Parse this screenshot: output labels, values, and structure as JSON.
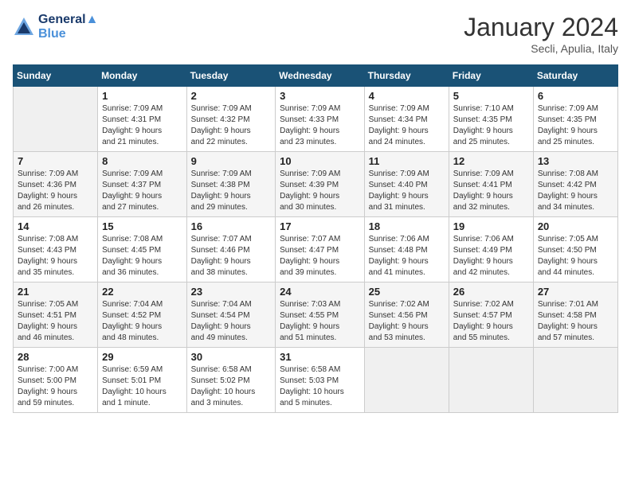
{
  "header": {
    "logo_line1": "General",
    "logo_line2": "Blue",
    "title": "January 2024",
    "subtitle": "Secli, Apulia, Italy"
  },
  "days_of_week": [
    "Sunday",
    "Monday",
    "Tuesday",
    "Wednesday",
    "Thursday",
    "Friday",
    "Saturday"
  ],
  "weeks": [
    [
      {
        "day": "",
        "info": ""
      },
      {
        "day": "1",
        "info": "Sunrise: 7:09 AM\nSunset: 4:31 PM\nDaylight: 9 hours\nand 21 minutes."
      },
      {
        "day": "2",
        "info": "Sunrise: 7:09 AM\nSunset: 4:32 PM\nDaylight: 9 hours\nand 22 minutes."
      },
      {
        "day": "3",
        "info": "Sunrise: 7:09 AM\nSunset: 4:33 PM\nDaylight: 9 hours\nand 23 minutes."
      },
      {
        "day": "4",
        "info": "Sunrise: 7:09 AM\nSunset: 4:34 PM\nDaylight: 9 hours\nand 24 minutes."
      },
      {
        "day": "5",
        "info": "Sunrise: 7:10 AM\nSunset: 4:35 PM\nDaylight: 9 hours\nand 25 minutes."
      },
      {
        "day": "6",
        "info": "Sunrise: 7:09 AM\nSunset: 4:35 PM\nDaylight: 9 hours\nand 25 minutes."
      }
    ],
    [
      {
        "day": "7",
        "info": "Sunrise: 7:09 AM\nSunset: 4:36 PM\nDaylight: 9 hours\nand 26 minutes."
      },
      {
        "day": "8",
        "info": "Sunrise: 7:09 AM\nSunset: 4:37 PM\nDaylight: 9 hours\nand 27 minutes."
      },
      {
        "day": "9",
        "info": "Sunrise: 7:09 AM\nSunset: 4:38 PM\nDaylight: 9 hours\nand 29 minutes."
      },
      {
        "day": "10",
        "info": "Sunrise: 7:09 AM\nSunset: 4:39 PM\nDaylight: 9 hours\nand 30 minutes."
      },
      {
        "day": "11",
        "info": "Sunrise: 7:09 AM\nSunset: 4:40 PM\nDaylight: 9 hours\nand 31 minutes."
      },
      {
        "day": "12",
        "info": "Sunrise: 7:09 AM\nSunset: 4:41 PM\nDaylight: 9 hours\nand 32 minutes."
      },
      {
        "day": "13",
        "info": "Sunrise: 7:08 AM\nSunset: 4:42 PM\nDaylight: 9 hours\nand 34 minutes."
      }
    ],
    [
      {
        "day": "14",
        "info": "Sunrise: 7:08 AM\nSunset: 4:43 PM\nDaylight: 9 hours\nand 35 minutes."
      },
      {
        "day": "15",
        "info": "Sunrise: 7:08 AM\nSunset: 4:45 PM\nDaylight: 9 hours\nand 36 minutes."
      },
      {
        "day": "16",
        "info": "Sunrise: 7:07 AM\nSunset: 4:46 PM\nDaylight: 9 hours\nand 38 minutes."
      },
      {
        "day": "17",
        "info": "Sunrise: 7:07 AM\nSunset: 4:47 PM\nDaylight: 9 hours\nand 39 minutes."
      },
      {
        "day": "18",
        "info": "Sunrise: 7:06 AM\nSunset: 4:48 PM\nDaylight: 9 hours\nand 41 minutes."
      },
      {
        "day": "19",
        "info": "Sunrise: 7:06 AM\nSunset: 4:49 PM\nDaylight: 9 hours\nand 42 minutes."
      },
      {
        "day": "20",
        "info": "Sunrise: 7:05 AM\nSunset: 4:50 PM\nDaylight: 9 hours\nand 44 minutes."
      }
    ],
    [
      {
        "day": "21",
        "info": "Sunrise: 7:05 AM\nSunset: 4:51 PM\nDaylight: 9 hours\nand 46 minutes."
      },
      {
        "day": "22",
        "info": "Sunrise: 7:04 AM\nSunset: 4:52 PM\nDaylight: 9 hours\nand 48 minutes."
      },
      {
        "day": "23",
        "info": "Sunrise: 7:04 AM\nSunset: 4:54 PM\nDaylight: 9 hours\nand 49 minutes."
      },
      {
        "day": "24",
        "info": "Sunrise: 7:03 AM\nSunset: 4:55 PM\nDaylight: 9 hours\nand 51 minutes."
      },
      {
        "day": "25",
        "info": "Sunrise: 7:02 AM\nSunset: 4:56 PM\nDaylight: 9 hours\nand 53 minutes."
      },
      {
        "day": "26",
        "info": "Sunrise: 7:02 AM\nSunset: 4:57 PM\nDaylight: 9 hours\nand 55 minutes."
      },
      {
        "day": "27",
        "info": "Sunrise: 7:01 AM\nSunset: 4:58 PM\nDaylight: 9 hours\nand 57 minutes."
      }
    ],
    [
      {
        "day": "28",
        "info": "Sunrise: 7:00 AM\nSunset: 5:00 PM\nDaylight: 9 hours\nand 59 minutes."
      },
      {
        "day": "29",
        "info": "Sunrise: 6:59 AM\nSunset: 5:01 PM\nDaylight: 10 hours\nand 1 minute."
      },
      {
        "day": "30",
        "info": "Sunrise: 6:58 AM\nSunset: 5:02 PM\nDaylight: 10 hours\nand 3 minutes."
      },
      {
        "day": "31",
        "info": "Sunrise: 6:58 AM\nSunset: 5:03 PM\nDaylight: 10 hours\nand 5 minutes."
      },
      {
        "day": "",
        "info": ""
      },
      {
        "day": "",
        "info": ""
      },
      {
        "day": "",
        "info": ""
      }
    ]
  ]
}
